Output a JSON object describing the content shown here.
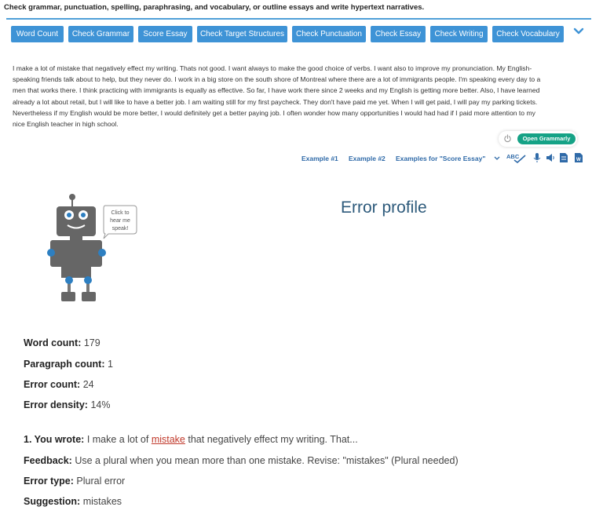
{
  "instructions": "Check grammar, punctuation, spelling, paraphrasing, and vocabulary, or outline essays and write hypertext narratives.",
  "toolbar": {
    "buttons": [
      "Word Count",
      "Check Grammar",
      "Score Essay",
      "Check Target Structures",
      "Check Punctuation",
      "Check Essay",
      "Check Writing",
      "Check Vocabulary"
    ],
    "accent": "#3e93d6"
  },
  "essay": {
    "lines": [
      "I make a lot of mistake that negatively effect my writing. Thats not good. I want always to make the good choice of verbs. I want also to improve my pronunciation. My English-",
      "speaking friends talk about to help, but they never do. I work in a big store on the south shore of Montreal where there are a lot of immigrants people. I'm speaking every day to a",
      "men that works there. I think practicing with immigrants is equally as effective. So far, I have work there since 2 weeks and my English is getting more better. Also, I have learned",
      "already a lot about retail, but I will like to have a better job. I am waiting still for my first paycheck. They don't have paid me yet. When I will get paid, I will pay my parking tickets.",
      "Nevertheless if my English would be more better, I would definitely get a better paying job. I often wonder how many opportunities I would had had if I paid more attention to my",
      "nice English teacher in high school."
    ]
  },
  "grammarly": {
    "button": "Open Grammarly",
    "color": "#15a286"
  },
  "examples": {
    "ex1": "Example #1",
    "ex2": "Example #2",
    "ex3": "Examples for \"Score Essay\""
  },
  "robot": {
    "bubble": [
      "Click to",
      "hear me",
      "speak!"
    ]
  },
  "profile": {
    "title": "Error profile",
    "word_count_label": "Word count:",
    "word_count": "179",
    "paragraph_count_label": "Paragraph count:",
    "paragraph_count": "1",
    "error_count_label": "Error count:",
    "error_count": "24",
    "error_density_label": "Error density:",
    "error_density": "14%"
  },
  "errors": [
    {
      "num_label": "1. You wrote:",
      "before": "I make a lot of",
      "word": "mistake",
      "after": "that negatively effect my writing. That...",
      "feedback_label": "Feedback:",
      "feedback": "Use a plural when you mean more than one mistake. Revise: \"mistakes\" (Plural needed)",
      "type_label": "Error type:",
      "type": "Plural error",
      "suggestion_label": "Suggestion:",
      "suggestion": "mistakes"
    }
  ]
}
